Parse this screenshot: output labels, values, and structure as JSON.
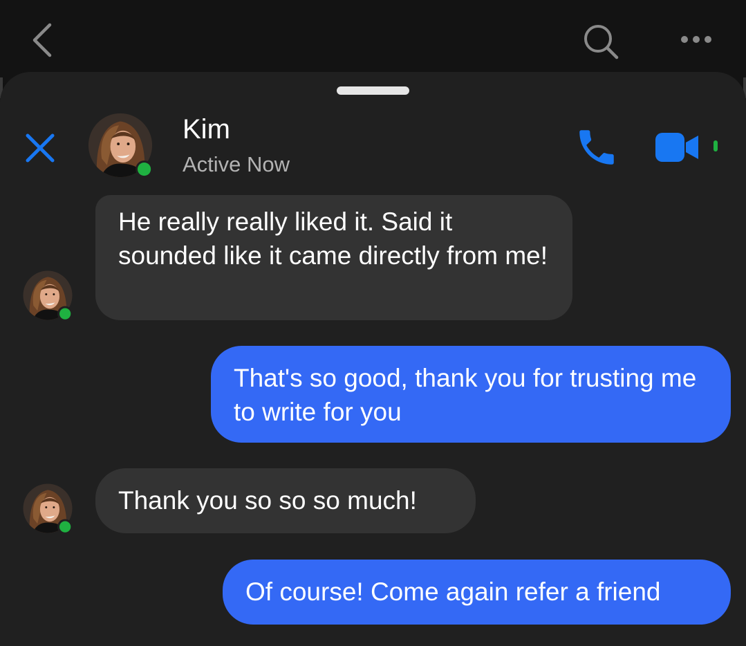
{
  "topbar": {
    "back_icon": "chevron-left-icon",
    "search_icon": "search-icon",
    "more_icon": "more-dots-icon"
  },
  "chat_header": {
    "close_icon": "close-icon",
    "contact_name": "Kim",
    "status": "Active Now",
    "call_icon": "phone-icon",
    "video_icon": "video-camera-icon",
    "accent_color": "#1877f2",
    "online_color": "#1fb141"
  },
  "messages": [
    {
      "direction": "incoming",
      "text": "He really really liked it.  Said it sounded like it came directly from me!"
    },
    {
      "direction": "outgoing",
      "text": "That's so good, thank you for trusting me to write for you"
    },
    {
      "direction": "incoming",
      "text": "Thank you so so so much!"
    },
    {
      "direction": "outgoing",
      "text": "Of course! Come again refer a friend"
    }
  ],
  "colors": {
    "incoming_bubble": "#333333",
    "outgoing_bubble": "#3469f5",
    "sheet_background": "#202020"
  }
}
